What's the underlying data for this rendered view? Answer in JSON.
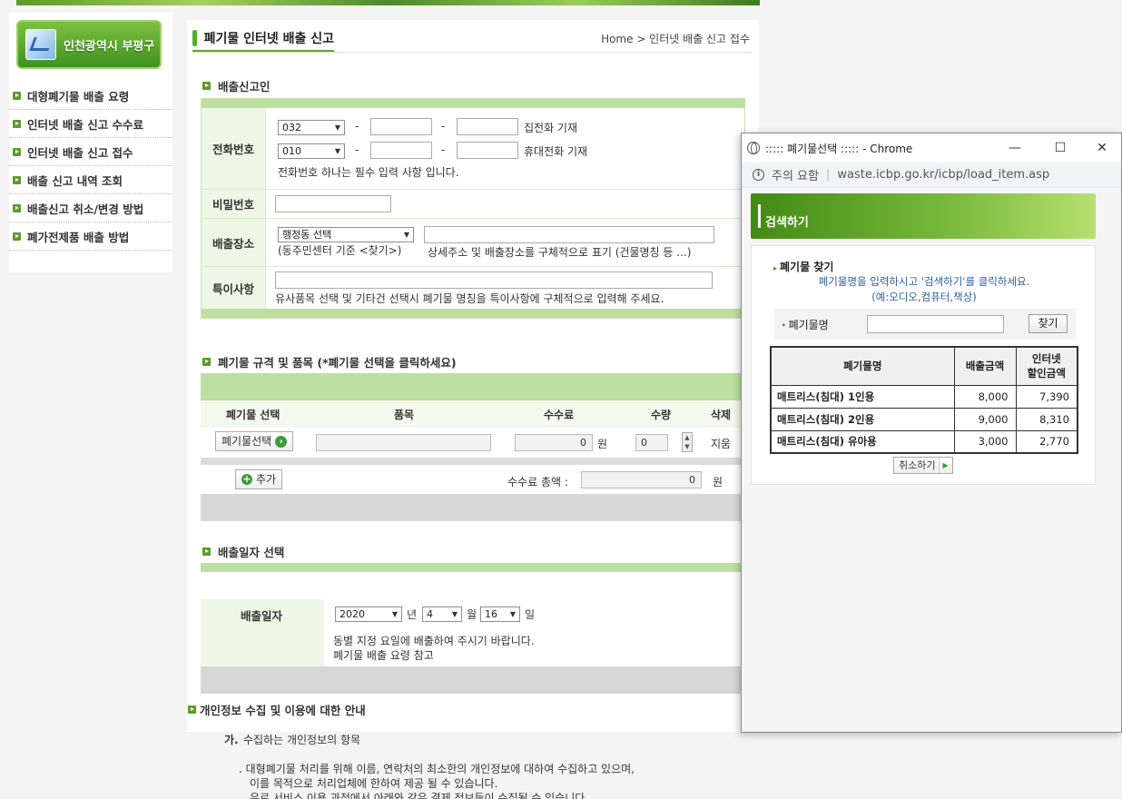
{
  "sidebar": {
    "logo_text": "인천광역시 부평구",
    "items": [
      {
        "label": "대형폐기물 배출 요령"
      },
      {
        "label": "인터넷 배출 신고 수수료"
      },
      {
        "label": "인터넷 배출 신고 접수"
      },
      {
        "label": "배출 신고 내역 조회"
      },
      {
        "label": "배출신고 취소/변경 방법"
      },
      {
        "label": "폐가전제품 배출 방법"
      }
    ]
  },
  "header": {
    "title": "폐기물 인터넷 배출 신고",
    "breadcrumb": "Home > 인터넷 배출 신고 접수"
  },
  "reporter": {
    "heading": "배출신고인",
    "phone_label": "전화번호",
    "home_area_code": "032",
    "home_note": "집전화 기재",
    "mobile_prefix": "010",
    "mobile_note": "휴대전화 기재",
    "phone_required_note": "전화번호 하나는 필수 입력 사항 입니다.",
    "password_label": "비밀번호",
    "location_label": "배출장소",
    "district_select": "행정동 선택",
    "district_note": "(동주민센터 기준 <찾기>)",
    "address_note": "상세주소 및 배출장소를 구체적으로 표기 (건물명칭 등 ...)",
    "remarks_label": "특이사항",
    "remarks_note": "유사품목 선택 및 기타건 선택시 폐기물 명칭을 특이사항에 구체적으로 입력해 주세요."
  },
  "waste": {
    "heading": "폐기물 규격 및 품목 (*폐기물 선택을 클릭하세요)",
    "col_select": "폐기물 선택",
    "col_item": "품목",
    "col_fee": "수수료",
    "col_qty": "수량",
    "col_delete": "삭제",
    "select_button": "폐기물선택",
    "fee_value": "0",
    "fee_unit": "원",
    "qty_value": "0",
    "delete_label": "지움",
    "add_button": "추가",
    "total_label": "수수료 총액 :",
    "total_value": "0",
    "total_unit": "원"
  },
  "date": {
    "heading": "배출일자 선택",
    "label": "배출일자",
    "year": "2020",
    "year_unit": "년",
    "month": "4",
    "month_unit": "월",
    "day": "16",
    "day_unit": "일",
    "note1": "동별 지정 요일에 배출하여 주시기 바랍니다.",
    "note2": "폐기물 배출 요령 참고"
  },
  "privacy": {
    "heading": "개인정보 수집 및 이용에 대한 안내",
    "sub_marker": "가.",
    "sub_heading": "수집하는 개인정보의 항목",
    "bullet_line1": ". 대형폐기물 처리를 위해 이름, 연락처의 최소한의 개인정보에 대하여 수집하고 있으며,",
    "bullet_line2": "이를 목적으로 처리업체에 한하여 제공 될 수 있습니다.",
    "bullet_line3": "은로 서비스 이용 과정에서 아래와 같은 결제 정보들이 수집될 수 있습니다."
  },
  "popup": {
    "window_title": "::::: 폐기물선택 ::::: - Chrome",
    "security_label": "주의 요함",
    "url": "waste.icbp.go.kr/icbp/load_item.asp",
    "header": "검색하기",
    "find_title": "폐기물 찾기",
    "hint1": "폐기물명을 입력하시고 '검색하기'를 클릭하세요.",
    "hint2": "(예:오디오,컴퓨터,책상)",
    "search_label": "폐기물명",
    "search_value": "",
    "search_button": "찾기",
    "table": {
      "col_name": "폐기물명",
      "col_fee": "배출금액",
      "col_internet_1": "인터넷",
      "col_internet_2": "할인금액",
      "rows": [
        {
          "name": "매트리스(침대) 1인용",
          "fee": "8,000",
          "discount": "7,390"
        },
        {
          "name": "매트리스(침대) 2인용",
          "fee": "9,000",
          "discount": "8,310"
        },
        {
          "name": "매트리스(침대) 유아용",
          "fee": "3,000",
          "discount": "2,770"
        }
      ]
    },
    "cancel_button": "취소하기"
  },
  "colors": {
    "accent_green": "#5aaa2a",
    "band_green": "#bde0a0",
    "label_bg": "#eef7e6"
  }
}
